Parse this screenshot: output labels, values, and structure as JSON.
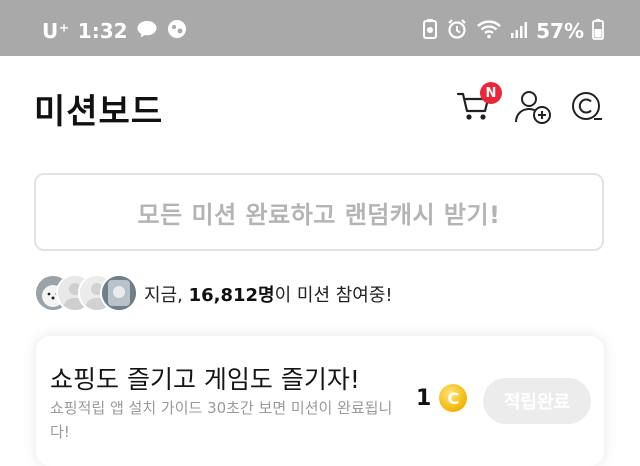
{
  "status_bar": {
    "carrier": "U⁺",
    "time": "1:32",
    "battery": "57%",
    "left_icons": [
      "talk-bubble-icon",
      "mouse-icon"
    ],
    "right_icons": [
      "recycle-icon",
      "alarm-icon",
      "wifi-icon",
      "signal-icon",
      "battery-icon"
    ]
  },
  "header": {
    "title": "미션보드",
    "cart_badge": "N",
    "icons": [
      "cart-icon",
      "add-user-icon",
      "coin-history-icon"
    ]
  },
  "banner": {
    "text": "모든 미션 완료하고 랜덤캐시 받기!"
  },
  "participants": {
    "prefix": "지금, ",
    "count": "16,812명",
    "suffix": "이 미션 참여중!"
  },
  "mission": {
    "title": "쇼핑도 즐기고 게임도 즐기자!",
    "description": "쇼핑적립 앱 설치 가이드 30초간 보면 미션이 완료됩니다!",
    "reward_amount": "1",
    "coin_symbol": "C",
    "button_label": "적립완료"
  },
  "colors": {
    "status_bar_bg": "#a9a9a9",
    "badge": "#e8283a",
    "coin": "#f2b705",
    "disabled_button": "#ececec"
  }
}
